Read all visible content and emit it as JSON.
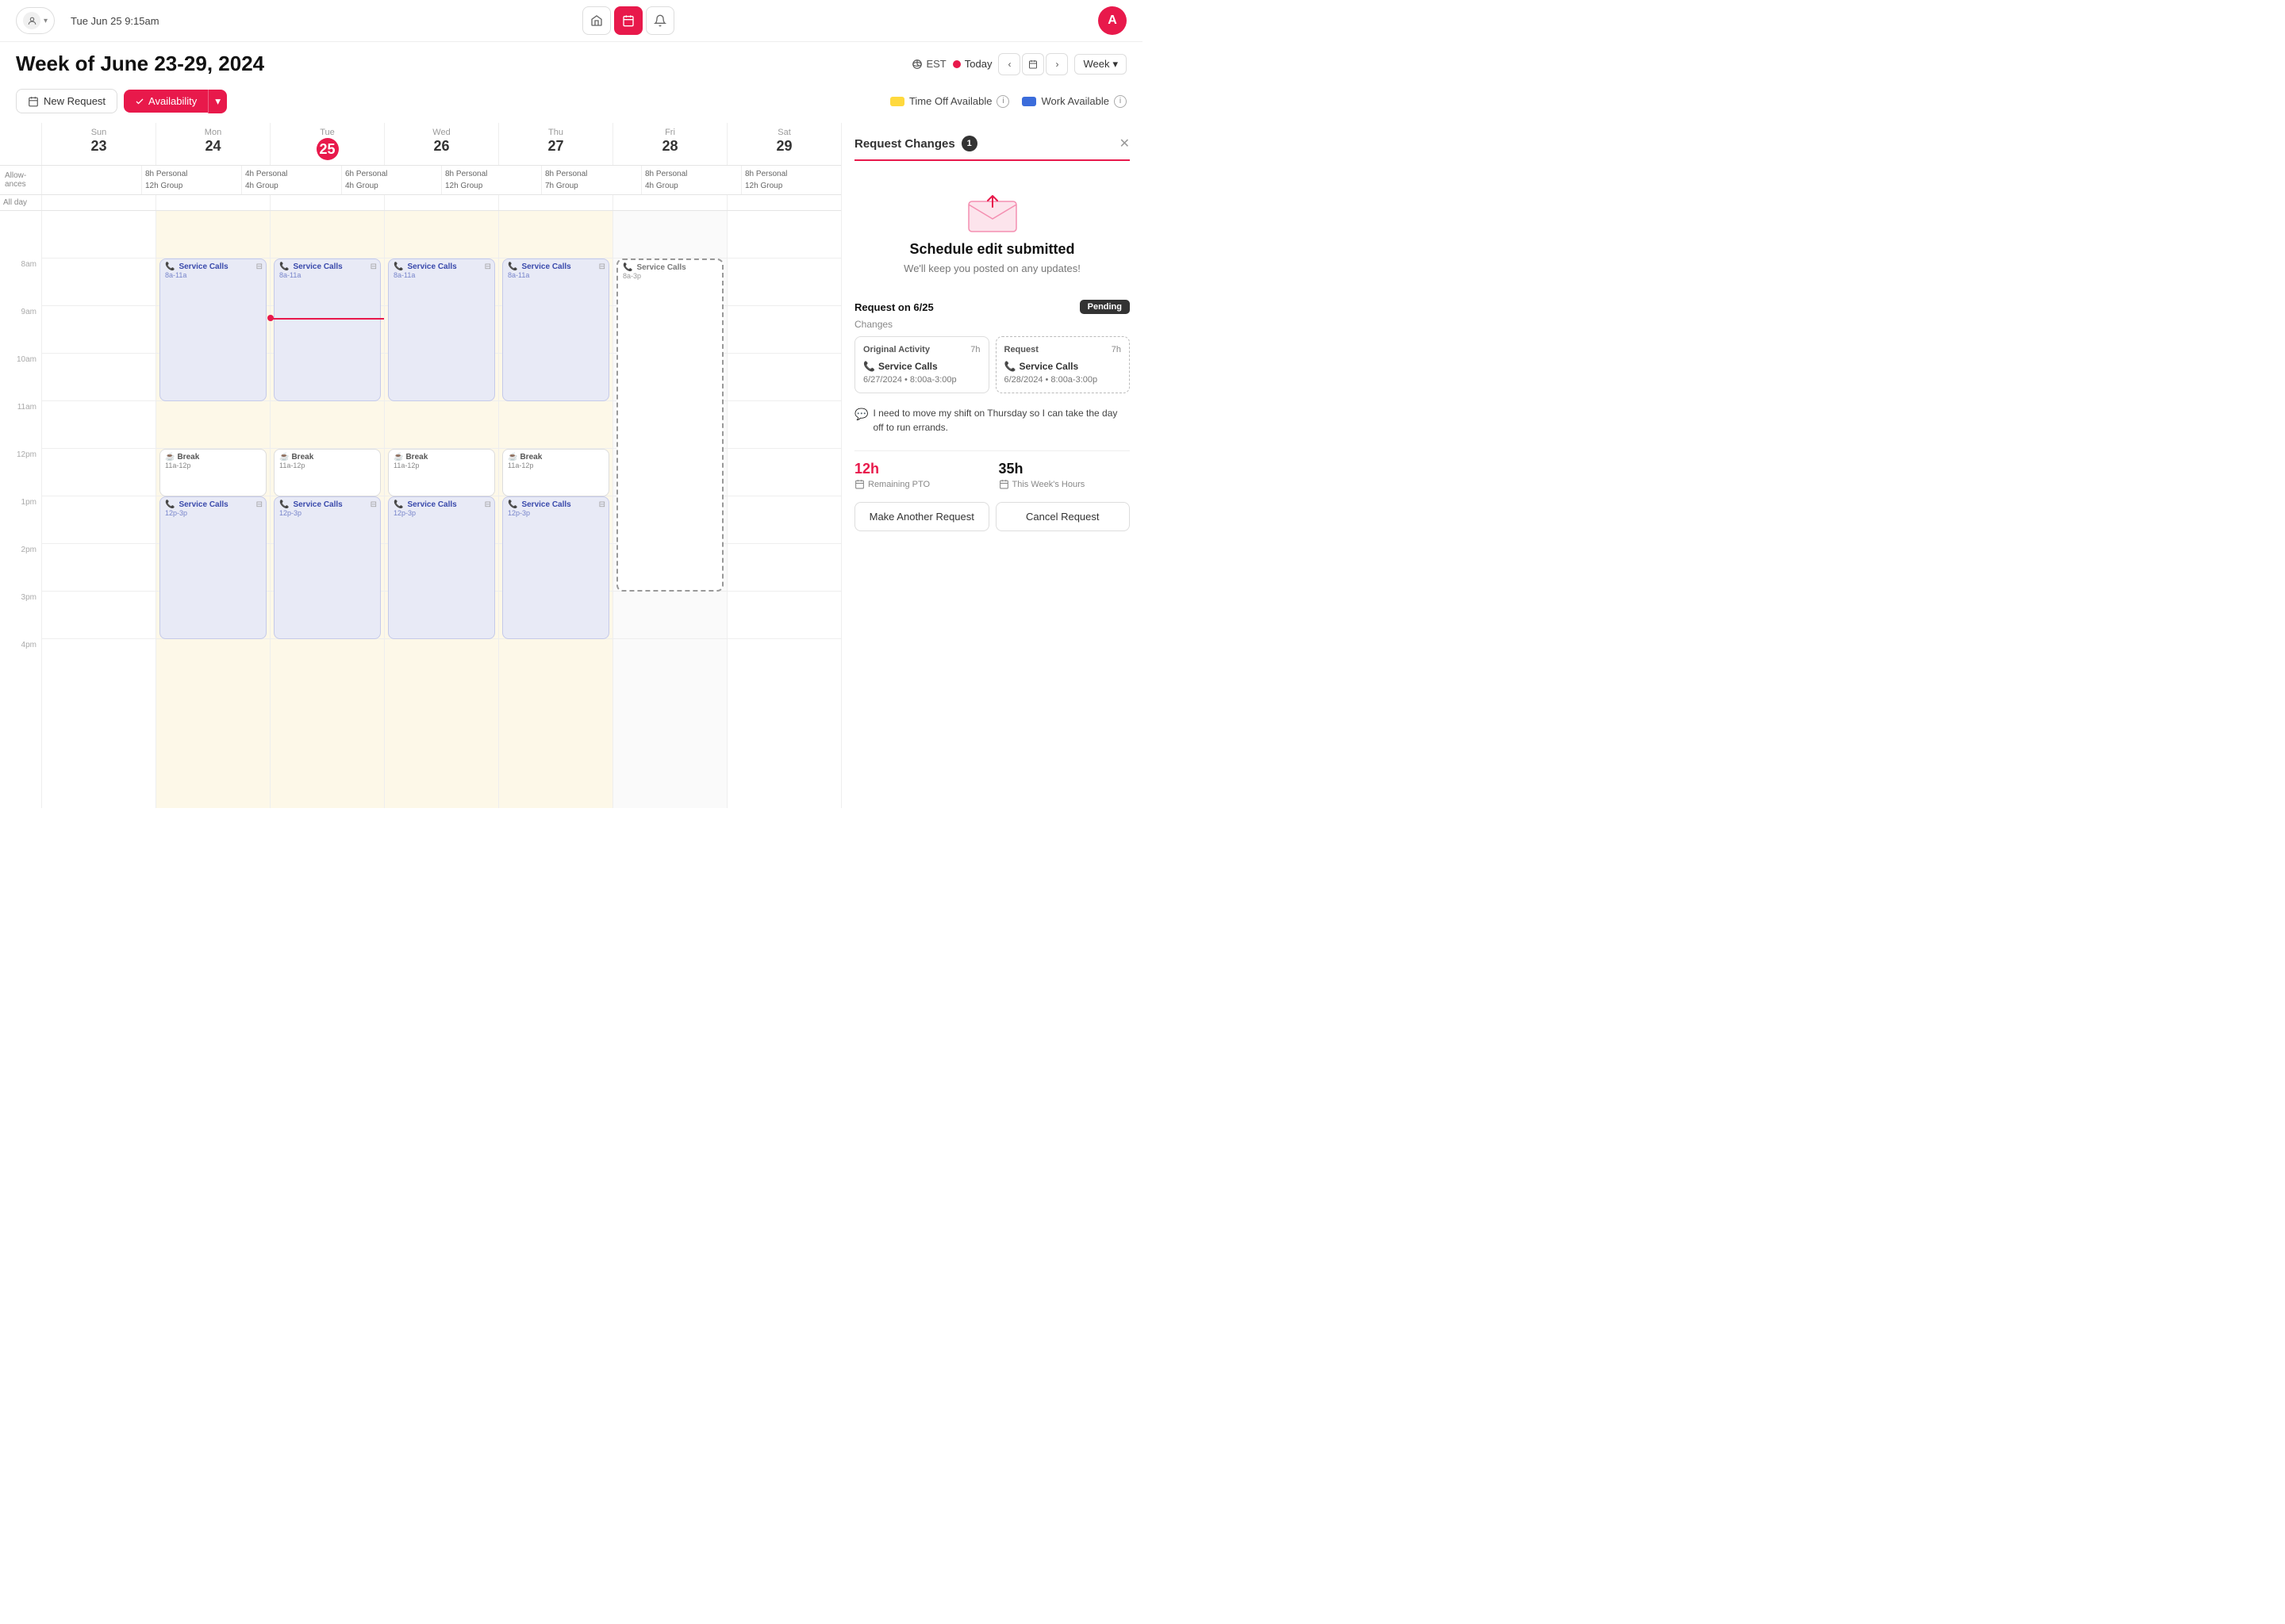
{
  "topbar": {
    "datetime": "Tue Jun 25 9:15am",
    "avatar_label": "A"
  },
  "page": {
    "title": "Week of June 23-29, 2024",
    "timezone": "EST",
    "today_label": "Today",
    "week_label": "Week"
  },
  "toolbar": {
    "new_request": "New Request",
    "availability": "Availability",
    "time_off_available": "Time Off Available",
    "work_available": "Work Available"
  },
  "calendar": {
    "days": [
      {
        "name": "Sun",
        "num": "23",
        "today": false
      },
      {
        "name": "Mon",
        "num": "24",
        "today": false
      },
      {
        "name": "Tue",
        "num": "25",
        "today": true
      },
      {
        "name": "Wed",
        "num": "26",
        "today": false
      },
      {
        "name": "Thu",
        "num": "27",
        "today": false
      },
      {
        "name": "Fri",
        "num": "28",
        "today": false
      },
      {
        "name": "Sat",
        "num": "29",
        "today": false
      }
    ],
    "allowances": [
      {
        "lines": []
      },
      {
        "lines": [
          "8h Personal",
          "12h Group"
        ]
      },
      {
        "lines": [
          "4h Personal",
          "4h Group"
        ]
      },
      {
        "lines": [
          "6h Personal",
          "4h Group"
        ]
      },
      {
        "lines": [
          "8h Personal",
          "12h Group"
        ]
      },
      {
        "lines": [
          "8h Personal",
          "7h Group"
        ]
      },
      {
        "lines": [
          "8h Personal",
          "4h Group"
        ]
      },
      {
        "lines": [
          "8h Personal",
          "12h Group"
        ]
      }
    ],
    "hours": [
      "8am",
      "9am",
      "10am",
      "11am",
      "12pm",
      "1pm",
      "2pm",
      "3pm",
      "4pm"
    ]
  },
  "panel": {
    "title": "Request Changes",
    "badge": "1",
    "submitted_title": "Schedule edit submitted",
    "submitted_sub": "We'll keep you posted on any updates!",
    "request_date": "Request on 6/25",
    "status": "Pending",
    "changes_label": "Changes",
    "original": {
      "label": "Original Activity",
      "hours": "7h",
      "service": "Service Calls",
      "date_time": "6/27/2024 • 8:00a-3:00p"
    },
    "request": {
      "label": "Request",
      "hours": "7h",
      "service": "Service Calls",
      "date_time": "6/28/2024 • 8:00a-3:00p"
    },
    "comment": "I need to move my shift on Thursday so I can take the day off to run errands.",
    "pto_value": "12h",
    "pto_label": "Remaining PTO",
    "hours_value": "35h",
    "hours_label": "This Week's Hours",
    "action1": "Make Another Request",
    "action2": "Cancel Request"
  }
}
